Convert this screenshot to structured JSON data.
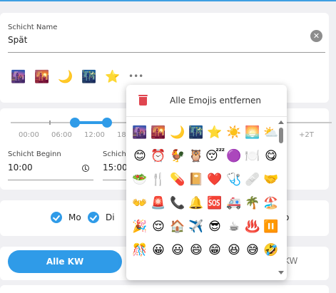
{
  "shift_name": {
    "label": "Schicht Name",
    "value": "Spät"
  },
  "selected_emojis": [
    "🌆",
    "🌇",
    "🌙",
    "🌃",
    "⭐"
  ],
  "more_label": "•••",
  "time_slider": {
    "labels": [
      "00:00",
      "06:00",
      "12:00",
      "18",
      "+2T"
    ],
    "start_value": "10:00",
    "end_value": "15:00"
  },
  "shift_start": {
    "label": "Schicht Beginn",
    "value": "10:00"
  },
  "shift_end": {
    "label": "Schich",
    "value": "15:00"
  },
  "weekdays": [
    {
      "label": "Mo",
      "checked": true
    },
    {
      "label": "Di",
      "checked": true
    }
  ],
  "weekday_trailing": "o",
  "kw": {
    "all_label": "Alle KW",
    "other_label": "KW"
  },
  "emoji_popup": {
    "title": "Alle Emojis entfernen",
    "rows": [
      [
        "🌆",
        "🌇",
        "🌙",
        "🌃",
        "⭐",
        "☀️",
        "🌅",
        "⛅"
      ],
      [
        "😊",
        "⏰",
        "🐓",
        "🦉",
        "😴",
        "🟣",
        "🍽️",
        "😋"
      ],
      [
        "🥗",
        "🍴",
        "💊",
        "📔",
        "❤️",
        "🩺",
        "🩹",
        "🤝"
      ],
      [
        "👐",
        "🚨",
        "📞",
        "🔔",
        "🆘",
        "🚑",
        "🌴",
        "🏖️"
      ],
      [
        "🎉",
        "😌",
        "🏠",
        "✈️",
        "😎",
        "☕",
        "♨️",
        "⏸️"
      ],
      [
        "🎊",
        "😀",
        "😃",
        "😄",
        "😁",
        "😆",
        "😅",
        "🤣"
      ]
    ]
  }
}
